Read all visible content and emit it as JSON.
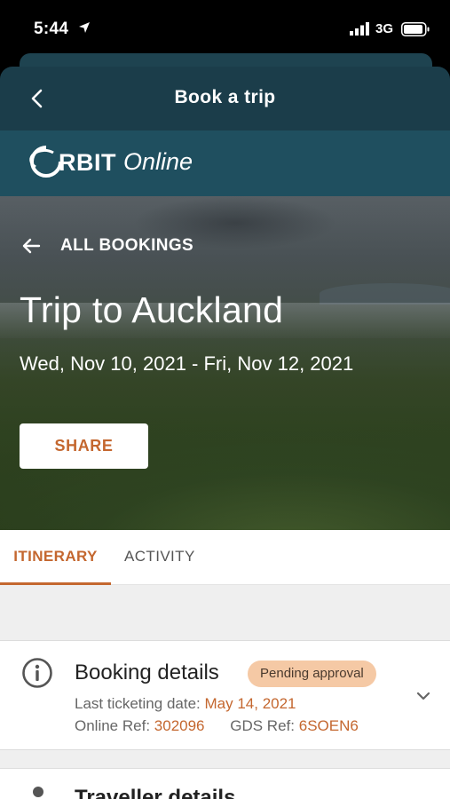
{
  "status_bar": {
    "time": "5:44",
    "network": "3G"
  },
  "header": {
    "title": "Book a trip"
  },
  "brand": {
    "name_bold": "RBIT",
    "name_italic": "Online"
  },
  "hero": {
    "back_label": "ALL BOOKINGS",
    "trip_title": "Trip to Auckland",
    "dates": "Wed, Nov 10, 2021 - Fri, Nov 12, 2021",
    "share_label": "SHARE"
  },
  "tabs": [
    {
      "label": "ITINERARY",
      "active": true
    },
    {
      "label": "ACTIVITY",
      "active": false
    }
  ],
  "booking_details": {
    "title": "Booking details",
    "status": "Pending approval",
    "last_ticketing_label": "Last ticketing date:",
    "last_ticketing_value": "May 14, 2021",
    "online_ref_label": "Online Ref:",
    "online_ref_value": "302096",
    "gds_ref_label": "GDS Ref:",
    "gds_ref_value": "6SOEN6"
  },
  "traveller_details": {
    "title": "Traveller details"
  },
  "colors": {
    "accent": "#c4672f",
    "header_bg": "#1b3d4a",
    "brand_bg": "#1f4f5f",
    "badge_bg": "#f5c9a5"
  }
}
